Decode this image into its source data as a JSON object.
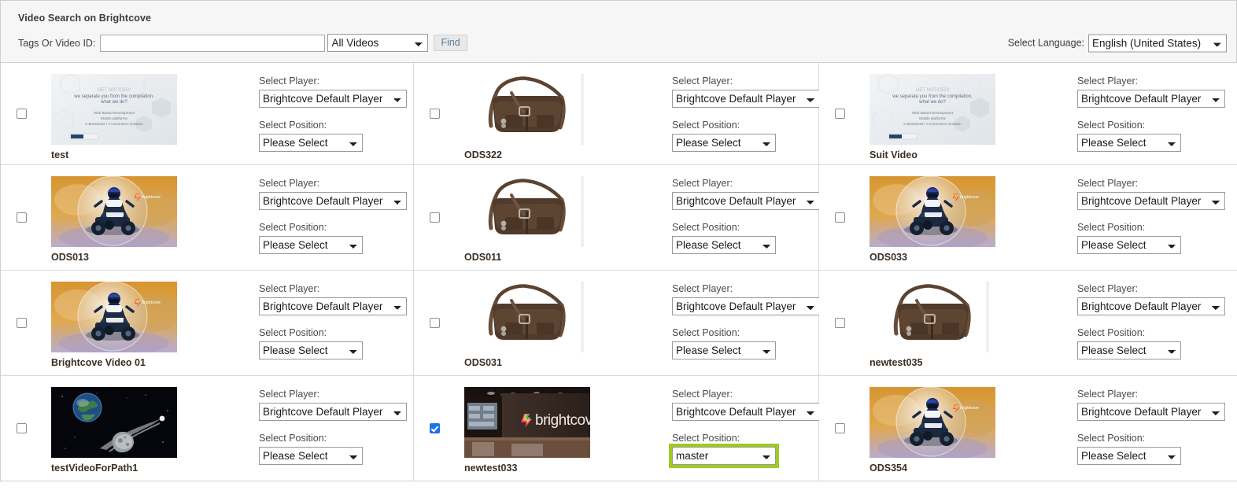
{
  "panel": {
    "title": "Video Search on Brightcove",
    "search": {
      "label": "Tags Or Video ID:",
      "input_value": "",
      "input_placeholder": "",
      "scope_selected": "All Videos",
      "scope_options": [
        "All Videos"
      ],
      "find_label": "Find"
    },
    "language": {
      "label": "Select Language:",
      "selected": "English (United States)",
      "options": [
        "English (United States)"
      ]
    }
  },
  "labels": {
    "select_player": "Select Player:",
    "select_position": "Select Position:"
  },
  "colors": {
    "highlight": "#9ecb20",
    "checkbox_checked": "#1a73e8",
    "panel_bg": "#f6f6f6",
    "border": "#d9d9d9",
    "find_text": "#5a7d9a"
  },
  "videos": [
    {
      "name": "test",
      "checked": false,
      "player": "Brightcove Default Player",
      "position": "Please Select",
      "position_highlighted": false,
      "thumb": "corporate-slide"
    },
    {
      "name": "ODS322",
      "checked": false,
      "player": "Brightcove Default Player",
      "position": "Please Select",
      "position_highlighted": false,
      "thumb": "leather-bag"
    },
    {
      "name": "Suit Video",
      "checked": false,
      "player": "Brightcove Default Player",
      "position": "Please Select",
      "position_highlighted": false,
      "thumb": "corporate-slide"
    },
    {
      "name": "ODS013",
      "checked": false,
      "player": "Brightcove Default Player",
      "position": "Please Select",
      "position_highlighted": false,
      "thumb": "atv-bubble"
    },
    {
      "name": "ODS011",
      "checked": false,
      "player": "Brightcove Default Player",
      "position": "Please Select",
      "position_highlighted": false,
      "thumb": "leather-bag"
    },
    {
      "name": "ODS033",
      "checked": false,
      "player": "Brightcove Default Player",
      "position": "Please Select",
      "position_highlighted": false,
      "thumb": "atv-bubble"
    },
    {
      "name": "Brightcove Video 01",
      "checked": false,
      "player": "Brightcove Default Player",
      "position": "Please Select",
      "position_highlighted": false,
      "thumb": "atv-bubble"
    },
    {
      "name": "ODS031",
      "checked": false,
      "player": "Brightcove Default Player",
      "position": "Please Select",
      "position_highlighted": false,
      "thumb": "leather-bag"
    },
    {
      "name": "newtest035",
      "checked": false,
      "player": "Brightcove Default Player",
      "position": "Please Select",
      "position_highlighted": false,
      "thumb": "leather-bag"
    },
    {
      "name": "testVideoForPath1",
      "checked": false,
      "player": "Brightcove Default Player",
      "position": "Please Select",
      "position_highlighted": false,
      "thumb": "earth-asteroid"
    },
    {
      "name": "newtest033",
      "checked": true,
      "player": "Brightcove Default Player",
      "position": "master",
      "position_highlighted": true,
      "thumb": "brightcove-office"
    },
    {
      "name": "ODS354",
      "checked": false,
      "player": "Brightcove Default Player",
      "position": "Please Select",
      "position_highlighted": false,
      "thumb": "atv-bubble"
    }
  ],
  "position_options": [
    "Please Select",
    "master"
  ],
  "player_options": [
    "Brightcove Default Player"
  ]
}
